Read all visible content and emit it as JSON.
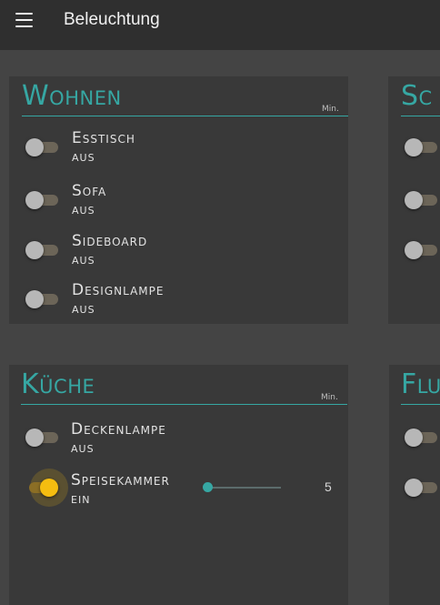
{
  "app": {
    "title": "Beleuchtung",
    "menu_icon": "hamburger-menu-icon"
  },
  "colors": {
    "accent": "#36a7a3",
    "toggle_on": "#f5bd10",
    "card_bg": "#393939",
    "page_bg": "#444444",
    "topbar_bg": "#2f2f2f"
  },
  "cards": {
    "wohnen": {
      "title": "Wohnen",
      "min_label": "Min.",
      "items": [
        {
          "name": "Esstisch",
          "state": "aus",
          "on": false
        },
        {
          "name": "Sofa",
          "state": "aus",
          "on": false
        },
        {
          "name": "Sideboard",
          "state": "aus",
          "on": false
        },
        {
          "name": "Designlampe",
          "state": "aus",
          "on": false
        }
      ]
    },
    "kueche": {
      "title": "Küche",
      "min_label": "Min.",
      "items": [
        {
          "name": "Deckenlampe",
          "state": "aus",
          "on": false
        },
        {
          "name": "Speisekammer",
          "state": "ein",
          "on": true,
          "slider_value": "5",
          "slider_fraction": 0.0
        }
      ]
    },
    "schlafen_partial": {
      "title": "Sc"
    },
    "flur_partial": {
      "title": "Flu"
    }
  }
}
